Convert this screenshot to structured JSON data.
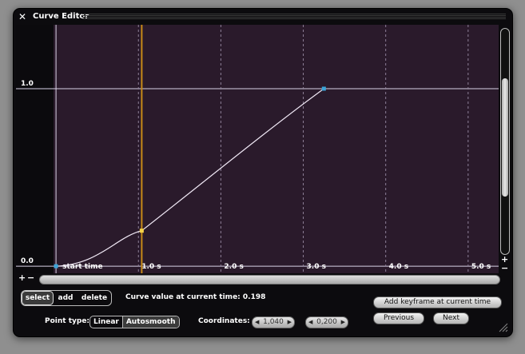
{
  "window": {
    "title": "Curve Editor"
  },
  "icons": {
    "close": "close-icon",
    "resize": "resize-grip-icon"
  },
  "chart_data": {
    "type": "line",
    "x_ticks": [
      1.0,
      2.0,
      3.0,
      4.0,
      5.0
    ],
    "x_tick_labels": [
      "1.0 s",
      "2.0 s",
      "3.0 s",
      "4.0 s",
      "5.0 s"
    ],
    "x_start_label": "start time",
    "y_tick_labels": [
      "0.0",
      "1.0"
    ],
    "xlim": [
      -0.03,
      5.37
    ],
    "ylim": [
      -0.04,
      1.36
    ],
    "series": [
      {
        "keyframes": [
          {
            "x": 0.0,
            "y": 0.0
          },
          {
            "x": 1.04,
            "y": 0.2
          },
          {
            "x": 3.25,
            "y": 1.0
          }
        ]
      }
    ],
    "current_time": 1.04,
    "colors": {
      "background": "#2a1a2b",
      "curve": "#f0e8f5",
      "keyframe": "#3aa4d8",
      "selected_keyframe": "#f4d24a",
      "playhead": "#c78a17"
    }
  },
  "scrollbars": {
    "zoom_in": "+",
    "zoom_out": "−"
  },
  "toolbar": {
    "modes": [
      "select",
      "add",
      "delete"
    ],
    "selected_mode": "select",
    "curve_value_text": "Curve value at current time: 0.198",
    "add_keyframe_label": "Add keyframe at current time",
    "previous_label": "Previous",
    "next_label": "Next",
    "point_type_label": "Point type:",
    "point_types": [
      "Linear",
      "Autosmooth"
    ],
    "selected_point_type": "Autosmooth",
    "coordinates_label": "Coordinates:",
    "coord_x": "1,040",
    "coord_y": "0,200"
  }
}
